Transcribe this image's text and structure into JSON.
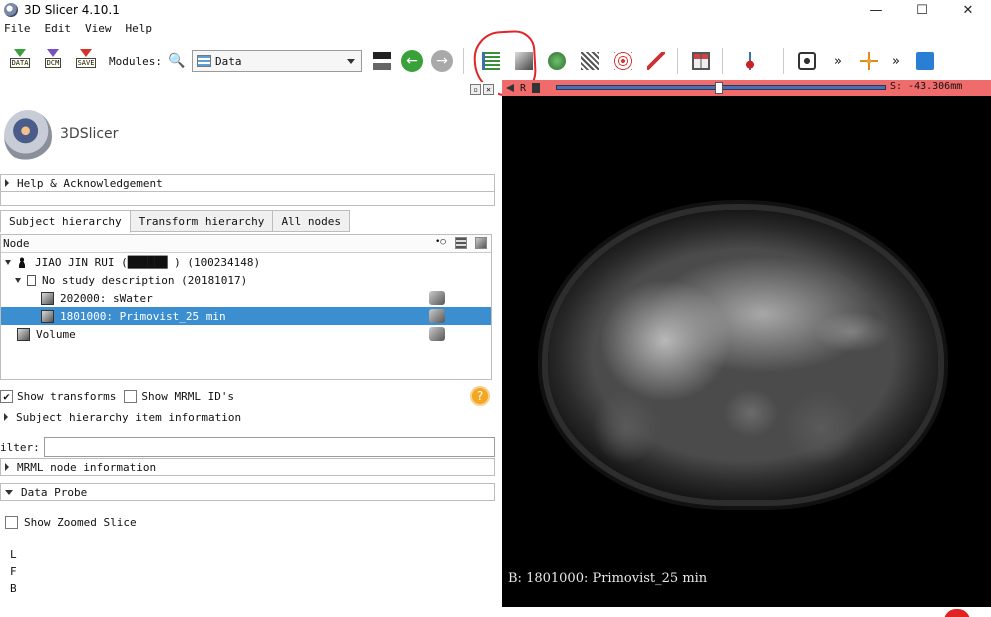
{
  "window": {
    "title": "3D Slicer 4.10.1",
    "minimize": "—",
    "maximize": "☐",
    "close": "✕"
  },
  "menu": [
    "File",
    "Edit",
    "View",
    "Help"
  ],
  "toolbar": {
    "data_label": "DATA",
    "dcm_label": "DCM",
    "save_label": "SAVE",
    "modules_label": "Modules:",
    "module_selected": "Data",
    "more1": "»",
    "more2": "»"
  },
  "logo": {
    "name": "3DSlicer"
  },
  "sections": {
    "help": "Help & Acknowledgement",
    "sh_info": "Subject hierarchy item information",
    "mrml_info": "MRML node information",
    "data_probe": "Data Probe"
  },
  "tabs": [
    "Subject hierarchy",
    "Transform hierarchy",
    "All nodes"
  ],
  "tree": {
    "header": "Node",
    "rows": [
      {
        "label": "JIAO JIN RUI (██████ ) (100234148)",
        "level": 0
      },
      {
        "label": "No study description (20181017)",
        "level": 1
      },
      {
        "label": "202000: sWater",
        "level": 2
      },
      {
        "label": "1801000: Primovist_25 min",
        "level": 2,
        "selected": true
      },
      {
        "label": "Volume",
        "level": 0
      }
    ]
  },
  "options": {
    "show_transforms": "Show transforms",
    "show_transforms_checked": "✔",
    "show_mrml_ids": "Show MRML ID's",
    "help_glyph": "?"
  },
  "filter": {
    "label": "ilter:",
    "value": ""
  },
  "probe": {
    "show_zoomed": "Show Zoomed Slice",
    "lines": [
      "L",
      "F",
      "B"
    ]
  },
  "viewer": {
    "orientation": "R",
    "offset": "S: -43.306mm",
    "caption": "B: 1801000: Primovist_25 min",
    "bar_color": "#f06b6b"
  }
}
